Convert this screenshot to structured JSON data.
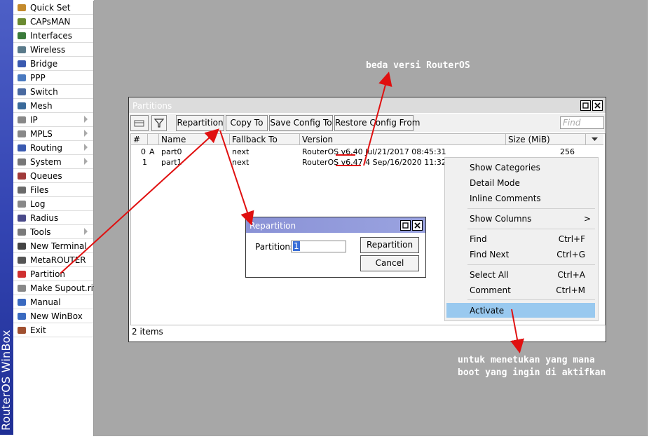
{
  "brand": "RouterOS WinBox",
  "menu": [
    {
      "label": "Quick Set",
      "icon": "quick-set-icon",
      "sub": false
    },
    {
      "label": "CAPsMAN",
      "icon": "capsman-icon",
      "sub": false
    },
    {
      "label": "Interfaces",
      "icon": "interfaces-icon",
      "sub": false
    },
    {
      "label": "Wireless",
      "icon": "wireless-icon",
      "sub": false
    },
    {
      "label": "Bridge",
      "icon": "bridge-icon",
      "sub": false
    },
    {
      "label": "PPP",
      "icon": "ppp-icon",
      "sub": false
    },
    {
      "label": "Switch",
      "icon": "switch-icon",
      "sub": false
    },
    {
      "label": "Mesh",
      "icon": "mesh-icon",
      "sub": false
    },
    {
      "label": "IP",
      "icon": "ip-icon",
      "sub": true
    },
    {
      "label": "MPLS",
      "icon": "mpls-icon",
      "sub": true
    },
    {
      "label": "Routing",
      "icon": "routing-icon",
      "sub": true
    },
    {
      "label": "System",
      "icon": "system-icon",
      "sub": true
    },
    {
      "label": "Queues",
      "icon": "queues-icon",
      "sub": false
    },
    {
      "label": "Files",
      "icon": "files-icon",
      "sub": false
    },
    {
      "label": "Log",
      "icon": "log-icon",
      "sub": false
    },
    {
      "label": "Radius",
      "icon": "radius-icon",
      "sub": false
    },
    {
      "label": "Tools",
      "icon": "tools-icon",
      "sub": true
    },
    {
      "label": "New Terminal",
      "icon": "terminal-icon",
      "sub": false
    },
    {
      "label": "MetaROUTER",
      "icon": "metarouter-icon",
      "sub": false
    },
    {
      "label": "Partition",
      "icon": "partition-icon",
      "sub": false
    },
    {
      "label": "Make Supout.rif",
      "icon": "supout-icon",
      "sub": false
    },
    {
      "label": "Manual",
      "icon": "manual-icon",
      "sub": false
    },
    {
      "label": "New WinBox",
      "icon": "new-winbox-icon",
      "sub": false
    },
    {
      "label": "Exit",
      "icon": "exit-icon",
      "sub": false
    }
  ],
  "partitions": {
    "title": "Partitions",
    "toolbar": {
      "repartition": "Repartition",
      "copy_to": "Copy To",
      "save_config": "Save Config To",
      "restore_config": "Restore Config From",
      "find_placeholder": "Find"
    },
    "columns": [
      "#",
      "Name",
      "Fallback To",
      "Version",
      "Size (MiB)"
    ],
    "rows": [
      {
        "num": "0",
        "flag": "A",
        "name": "part0",
        "fallback": "next",
        "version": "RouterOS v6.40 Jul/21/2017 08:45:31",
        "size": "256"
      },
      {
        "num": "1",
        "flag": "",
        "name": "part1",
        "fallback": "next",
        "version": "RouterOS v6.47.4 Sep/16/2020 11:32:37",
        "size": ""
      }
    ],
    "status": "2 items"
  },
  "context_menu": [
    {
      "label": "Show Categories",
      "shortcut": ""
    },
    {
      "label": "Detail Mode",
      "shortcut": ""
    },
    {
      "label": "Inline Comments",
      "shortcut": ""
    },
    {
      "label": "Show Columns",
      "shortcut": ">"
    },
    {
      "label": "Find",
      "shortcut": "Ctrl+F"
    },
    {
      "label": "Find Next",
      "shortcut": "Ctrl+G"
    },
    {
      "label": "Select All",
      "shortcut": "Ctrl+A"
    },
    {
      "label": "Comment",
      "shortcut": "Ctrl+M"
    },
    {
      "label": "Activate",
      "shortcut": ""
    }
  ],
  "repartition_dialog": {
    "title": "Repartition",
    "field_label": "Partitions:",
    "field_value": "1",
    "ok": "Repartition",
    "cancel": "Cancel"
  },
  "annotations": {
    "version_note": "beda versi RouterOS",
    "activate_note_1": "untuk menetukan yang mana",
    "activate_note_2": "boot yang ingin di aktifkan"
  },
  "colors": {
    "arrow": "#e01010",
    "selected": "#99c9ef",
    "brand": "#3445b3",
    "workspace": "#a7a7a7"
  }
}
